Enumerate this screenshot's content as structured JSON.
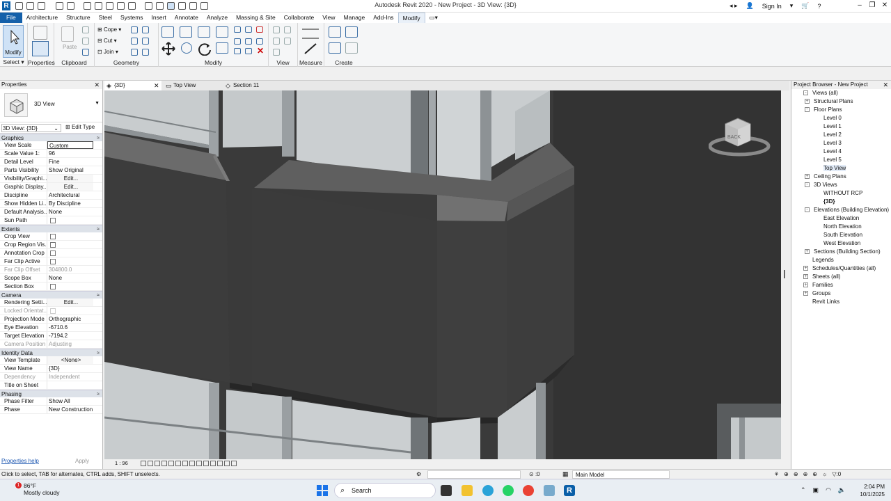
{
  "app": {
    "title": "Autodesk Revit 2020 - New Project - 3D View: {3D}",
    "sign_in": "Sign In",
    "logo": "R"
  },
  "menu": {
    "tabs": [
      "File",
      "Architecture",
      "Structure",
      "Steel",
      "Systems",
      "Insert",
      "Annotate",
      "Analyze",
      "Massing & Site",
      "Collaborate",
      "View",
      "Manage",
      "Add-Ins",
      "Modify"
    ],
    "active": "Modify"
  },
  "ribbon": {
    "modify_btn": "Modify",
    "select": "Select",
    "properties": "Properties",
    "paste": "Paste",
    "clipboard": "Clipboard",
    "cope": "Cope",
    "cut": "Cut",
    "join": "Join",
    "geometry": "Geometry",
    "modify": "Modify",
    "view": "View",
    "measure": "Measure",
    "create": "Create"
  },
  "properties": {
    "header": "Properties",
    "type_name": "3D View",
    "view_selector": "3D View: {3D}",
    "edit_type": "Edit Type",
    "sections": [
      {
        "name": "Graphics",
        "rows": [
          {
            "k": "View Scale",
            "v": "Custom",
            "style": "box"
          },
          {
            "k": "Scale Value    1:",
            "v": "96"
          },
          {
            "k": "Detail Level",
            "v": "Fine"
          },
          {
            "k": "Parts Visibility",
            "v": "Show Original"
          },
          {
            "k": "Visibility/Graphi...",
            "v": "Edit...",
            "style": "btn"
          },
          {
            "k": "Graphic Display...",
            "v": "Edit...",
            "style": "btn"
          },
          {
            "k": "Discipline",
            "v": "Architectural"
          },
          {
            "k": "Show Hidden Li...",
            "v": "By Discipline"
          },
          {
            "k": "Default Analysis...",
            "v": "None"
          },
          {
            "k": "Sun Path",
            "v": "",
            "style": "cb"
          }
        ]
      },
      {
        "name": "Extents",
        "rows": [
          {
            "k": "Crop View",
            "v": "",
            "style": "cb"
          },
          {
            "k": "Crop Region Vis...",
            "v": "",
            "style": "cb"
          },
          {
            "k": "Annotation Crop",
            "v": "",
            "style": "cb"
          },
          {
            "k": "Far Clip Active",
            "v": "",
            "style": "cb"
          },
          {
            "k": "Far Clip Offset",
            "v": "304800.0",
            "style": "dim"
          },
          {
            "k": "Scope Box",
            "v": "None"
          },
          {
            "k": "Section Box",
            "v": "",
            "style": "cb"
          }
        ]
      },
      {
        "name": "Camera",
        "rows": [
          {
            "k": "Rendering Setti...",
            "v": "Edit...",
            "style": "btn"
          },
          {
            "k": "Locked Orientat...",
            "v": "",
            "style": "dimcb"
          },
          {
            "k": "Projection Mode",
            "v": "Orthographic"
          },
          {
            "k": "Eye Elevation",
            "v": "-6710.6"
          },
          {
            "k": "Target Elevation",
            "v": "-7194.2"
          },
          {
            "k": "Camera Position",
            "v": "Adjusting",
            "style": "dim"
          }
        ]
      },
      {
        "name": "Identity Data",
        "rows": [
          {
            "k": "View Template",
            "v": "<None>",
            "style": "btn"
          },
          {
            "k": "View Name",
            "v": "{3D}"
          },
          {
            "k": "Dependency",
            "v": "Independent",
            "style": "dim"
          },
          {
            "k": "Title on Sheet",
            "v": ""
          }
        ]
      },
      {
        "name": "Phasing",
        "rows": [
          {
            "k": "Phase Filter",
            "v": "Show All"
          },
          {
            "k": "Phase",
            "v": "New Construction"
          }
        ]
      }
    ],
    "help": "Properties help",
    "apply": "Apply"
  },
  "view_tabs": [
    {
      "label": "{3D}",
      "active": true
    },
    {
      "label": "Top View",
      "active": false
    },
    {
      "label": "Section 11",
      "active": false
    }
  ],
  "viewbar": {
    "scale": "1 : 96"
  },
  "viewcube": {
    "face": "BACK"
  },
  "browser": {
    "header": "Project Browser - New Project",
    "nodes": [
      {
        "label": "Views (all)",
        "level": 0,
        "exp": "-"
      },
      {
        "label": "Structural Plans",
        "level": 1,
        "exp": "+"
      },
      {
        "label": "Floor Plans",
        "level": 1,
        "exp": "-"
      },
      {
        "label": "Level 0",
        "level": 2
      },
      {
        "label": "Level 1",
        "level": 2
      },
      {
        "label": "Level 2",
        "level": 2
      },
      {
        "label": "Level 3",
        "level": 2
      },
      {
        "label": "Level 4",
        "level": 2
      },
      {
        "label": "Level 5",
        "level": 2
      },
      {
        "label": "Top View",
        "level": 2,
        "sel": true
      },
      {
        "label": "Ceiling Plans",
        "level": 1,
        "exp": "+"
      },
      {
        "label": "3D Views",
        "level": 1,
        "exp": "-"
      },
      {
        "label": "WITHOUT RCP",
        "level": 2
      },
      {
        "label": "{3D}",
        "level": 2,
        "bold": true
      },
      {
        "label": "Elevations (Building Elevation)",
        "level": 1,
        "exp": "-"
      },
      {
        "label": "East Elevation",
        "level": 2
      },
      {
        "label": "North Elevation",
        "level": 2
      },
      {
        "label": "South Elevation",
        "level": 2
      },
      {
        "label": "West Elevation",
        "level": 2
      },
      {
        "label": "Sections (Building Section)",
        "level": 1,
        "exp": "+"
      },
      {
        "label": "Legends",
        "level": 0
      },
      {
        "label": "Schedules/Quantities (all)",
        "level": 0,
        "exp": "+"
      },
      {
        "label": "Sheets (all)",
        "level": 0,
        "exp": "+"
      },
      {
        "label": "Families",
        "level": 0,
        "exp": "+"
      },
      {
        "label": "Groups",
        "level": 0,
        "exp": "+"
      },
      {
        "label": "Revit Links",
        "level": 0
      }
    ]
  },
  "status": {
    "text": "Click to select, TAB for alternates, CTRL adds, SHIFT unselects.",
    "coord": ":0",
    "model": "Main Model",
    "filter_count": ":0"
  },
  "taskbar": {
    "temp": "86°F",
    "weather": "Mostly cloudy",
    "badge": "1",
    "search": "Search",
    "time": "2:04 PM",
    "date": "10/1/2025"
  },
  "colors": {
    "file_tab": "#1460aa",
    "viewport_bg": "#3a3a3a",
    "glass": "#c8ccce",
    "panel_dark": "#2f2f2f"
  }
}
